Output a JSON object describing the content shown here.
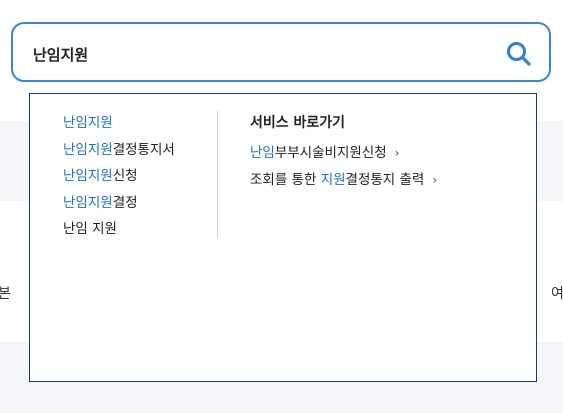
{
  "search": {
    "value": "난임지원"
  },
  "suggestions": [
    {
      "highlight": "난임지원",
      "rest": ""
    },
    {
      "highlight": "난임지원",
      "rest": "결정통지서"
    },
    {
      "highlight": "난임지원",
      "rest": "신청"
    },
    {
      "highlight": "난임지원",
      "rest": "결정"
    },
    {
      "highlight": "",
      "rest": "난임 지원"
    }
  ],
  "services": {
    "title": "서비스 바로가기",
    "links": [
      {
        "pre": "",
        "highlight": "난임",
        "post": "부부시술비지원신청",
        "chevron": "›"
      },
      {
        "pre": "조회를 통한 ",
        "highlight": "지원",
        "post": "결정통지 출력",
        "chevron": "›"
      }
    ]
  },
  "background": {
    "left_edge_text": "본",
    "right_edge_text": "여"
  },
  "colors": {
    "accent": "#3b86d6",
    "highlight_text": "#1f6fc5",
    "dropdown_border": "#1c3a6e",
    "band": "#f4f5f8"
  },
  "icons": {
    "search_button": "search-icon"
  }
}
